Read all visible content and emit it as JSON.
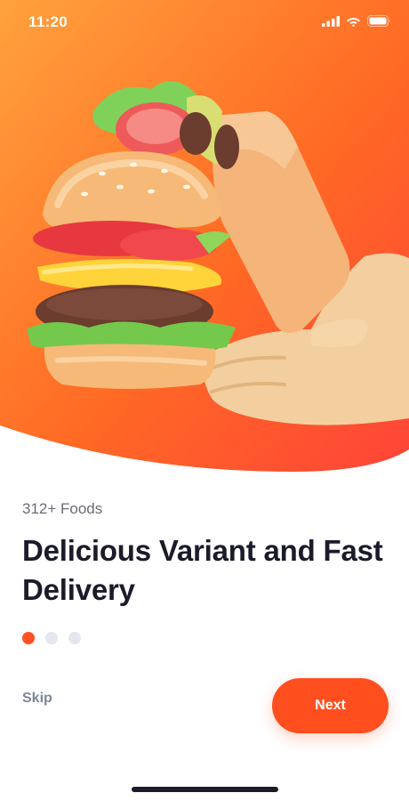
{
  "status_bar": {
    "time": "11:20",
    "icons": [
      "signal-icon",
      "wifi-icon",
      "battery-icon"
    ]
  },
  "hero": {
    "gradient": [
      "#ff9a3c",
      "#ff5a1f",
      "#ff4a3a"
    ],
    "illustration": "burger-in-hand-illustration"
  },
  "onboarding": {
    "subtitle": "312+ Foods",
    "headline": "Delicious Variant and Fast Delivery",
    "page_indicator": {
      "total": 3,
      "active": 1
    }
  },
  "actions": {
    "skip_label": "Skip",
    "next_label": "Next"
  },
  "colors": {
    "accent": "#ff4f1f",
    "text_primary": "#1b1b2a",
    "text_secondary": "#6b6b78",
    "dot_inactive": "#e4e7ee"
  }
}
